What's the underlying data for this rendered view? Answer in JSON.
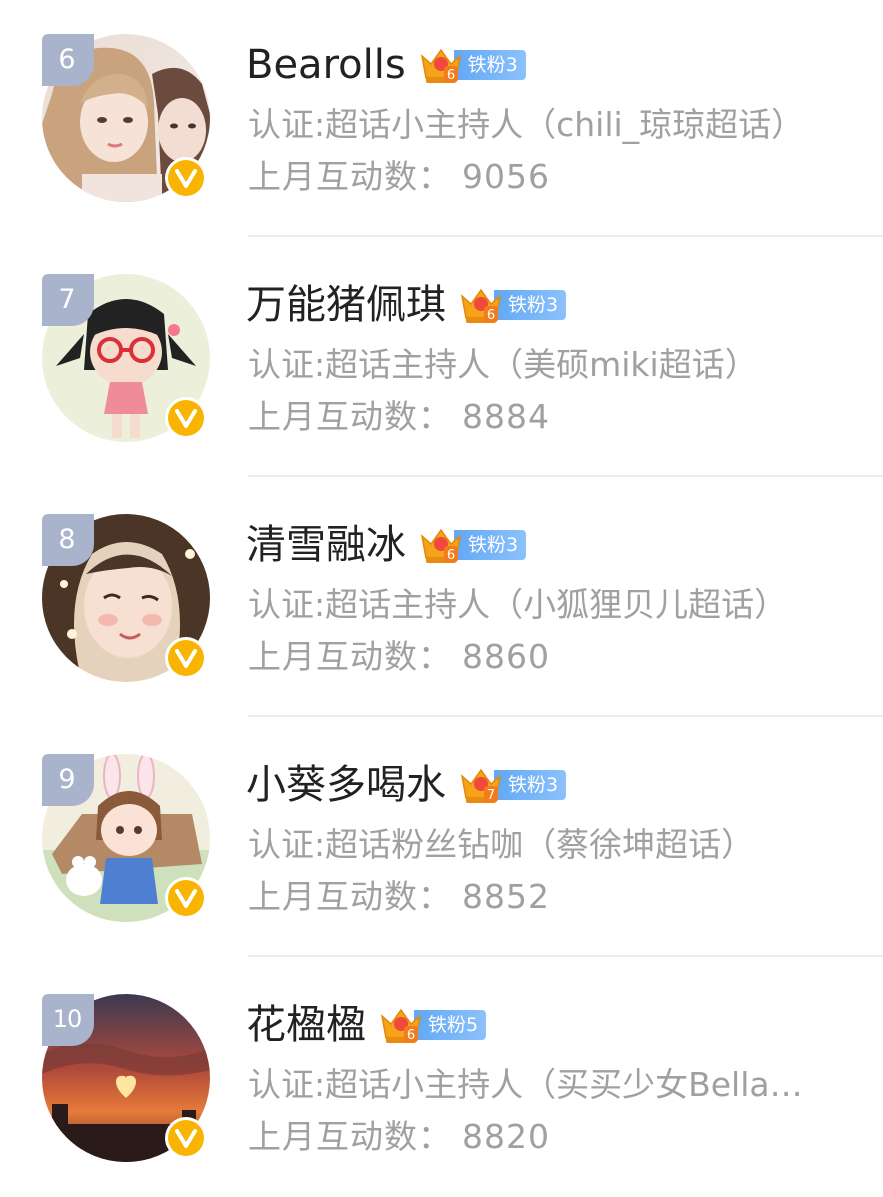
{
  "colors": {
    "rank_badge": "#aab3cc",
    "verified_badge": "#f8b400",
    "fan_badge": "#62a8f5",
    "crown": "#f6a21a",
    "name_text": "#222222",
    "secondary_text": "#a0a0a0"
  },
  "stat_label": "上月互动数：",
  "users": [
    {
      "rank": "6",
      "name": "Bearolls",
      "crown_level": "6",
      "fan_badge": "铁粉3",
      "certification": "认证:超话小主持人（chili_琼琼超话）",
      "interactions": "9056",
      "avatar_icon": "photo-avatar-icon",
      "verified_icon": "verified-v-icon"
    },
    {
      "rank": "7",
      "name": "万能猪佩琪",
      "crown_level": "6",
      "fan_badge": "铁粉3",
      "certification": "认证:超话主持人（美硕miki超话）",
      "interactions": "8884",
      "avatar_icon": "cartoon-girl-avatar-icon",
      "verified_icon": "verified-v-icon"
    },
    {
      "rank": "8",
      "name": "清雪融冰",
      "crown_level": "6",
      "fan_badge": "铁粉3",
      "certification": "认证:超话主持人（小狐狸贝儿超话）",
      "interactions": "8860",
      "avatar_icon": "illustrated-girl-avatar-icon",
      "verified_icon": "verified-v-icon"
    },
    {
      "rank": "9",
      "name": "小葵多喝水",
      "crown_level": "7",
      "fan_badge": "铁粉3",
      "certification": "认证:超话粉丝钻咖（蔡徐坤超话）",
      "interactions": "8852",
      "avatar_icon": "cartoon-bunny-boy-avatar-icon",
      "verified_icon": "verified-v-icon"
    },
    {
      "rank": "10",
      "name": "花楹楹",
      "crown_level": "6",
      "fan_badge": "铁粉5",
      "certification": "认证:超话小主持人（买买少女Bella…",
      "interactions": "8820",
      "avatar_icon": "sunset-heart-avatar-icon",
      "verified_icon": "verified-v-icon"
    }
  ]
}
